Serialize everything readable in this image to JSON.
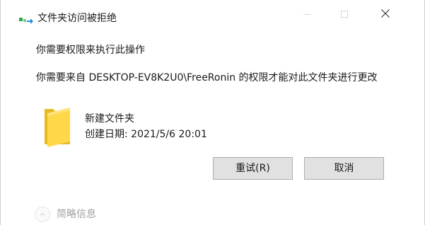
{
  "window": {
    "title": "文件夹访问被拒绝",
    "controls": {
      "minimize_icon": "minimize-icon",
      "maximize_icon": "maximize-icon",
      "close_icon": "close-icon"
    }
  },
  "dialog": {
    "heading": "你需要权限来执行此操作",
    "message": "你需要来自 DESKTOP-EV8K2U0\\FreeRonin 的权限才能对此文件夹进行更改",
    "item": {
      "icon": "folder-icon",
      "name": "新建文件夹",
      "created_label": "创建日期:",
      "created_value": "2021/5/6 20:01"
    },
    "buttons": {
      "retry_label": "重试(R)",
      "cancel_label": "取消"
    },
    "details": {
      "label": "简略信息",
      "icon": "chevron-up-icon"
    }
  },
  "colors": {
    "folder": "#ffd84a",
    "folder_dark": "#e8b923",
    "button_bg": "#e1e1e1",
    "button_border": "#adadad",
    "icon_green": "#2ca84c",
    "icon_blue": "#1f8de0"
  }
}
